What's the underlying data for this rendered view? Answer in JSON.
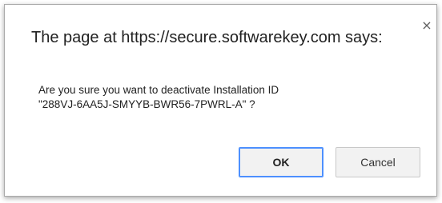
{
  "dialog": {
    "close_glyph": "×",
    "title": "The page at https://secure.softwarekey.com says:",
    "message_line1": "Are you sure you want to deactivate Installation ID",
    "message_line2": "\"288VJ-6AA5J-SMYYB-BWR56-7PWRL-A\" ?",
    "ok_label": "OK",
    "cancel_label": "Cancel",
    "focus_color": "#4d90fe"
  }
}
